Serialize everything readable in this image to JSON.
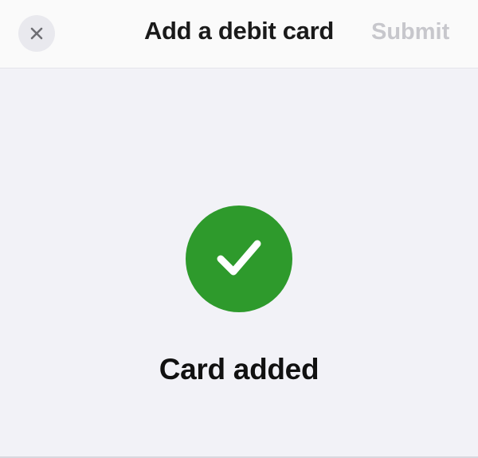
{
  "header": {
    "close_icon": "close-icon",
    "title": "Add a debit card",
    "submit_label": "Submit"
  },
  "status": {
    "icon": "checkmark-icon",
    "message": "Card added"
  },
  "colors": {
    "success_green": "#2e9a2c",
    "disabled_text": "#c7c7cc",
    "background": "#f2f2f7"
  }
}
